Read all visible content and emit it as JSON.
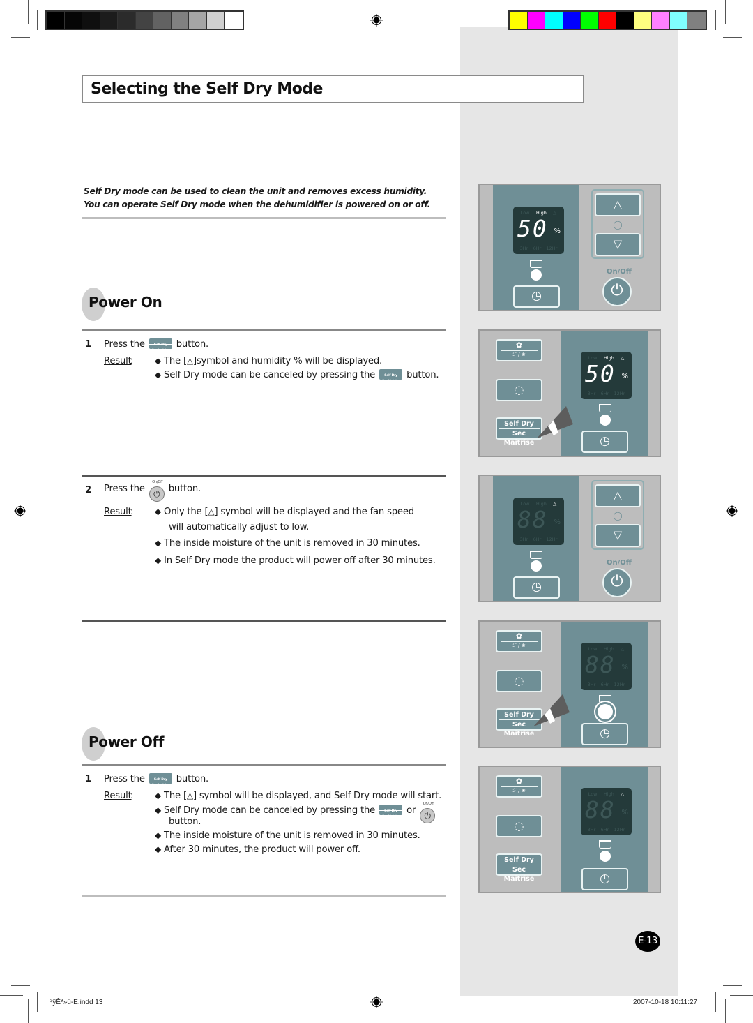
{
  "print_marks": {
    "gray_bar": [
      "#000000",
      "#060606",
      "#0f0f0f",
      "#1c1c1c",
      "#2b2b2b",
      "#434343",
      "#626262",
      "#808080",
      "#a5a5a5",
      "#d0d0d0",
      "#ffffff"
    ],
    "color_bar": [
      "#ffff00",
      "#ff00ff",
      "#00ffff",
      "#0000ff",
      "#00ff00",
      "#ff0000",
      "#000000",
      "#ffff80",
      "#ff80ff",
      "#80ffff",
      "#808080"
    ]
  },
  "page": {
    "title": "Selecting the Self Dry Mode",
    "intro_line1": "Self Dry mode can be used to clean the unit and removes excess humidity.",
    "intro_line2": "You can operate Self Dry mode when the dehumidifier is powered on or off.",
    "page_number": "E-13"
  },
  "power_on": {
    "heading": "Power On",
    "step1": {
      "num": "1",
      "press_prefix": "Press the",
      "press_suffix": "button.",
      "result_label": "Result",
      "bullets": [
        {
          "pre": "The [",
          "post": "]symbol and humidity % will be displayed."
        },
        {
          "pre": "Self Dry mode can be canceled by pressing the",
          "post": "button."
        }
      ]
    },
    "step2": {
      "num": "2",
      "press_prefix": "Press the",
      "press_suffix": "button.",
      "result_label": "Result",
      "bullets": [
        {
          "pre": "Only the [",
          "post": "] symbol will be displayed and the fan speed",
          "cont": "will automatically adjust to low."
        },
        {
          "text": "The inside moisture of the unit is removed in 30 minutes."
        },
        {
          "text": "In Self Dry mode the product will power off after 30 minutes."
        }
      ]
    }
  },
  "power_off": {
    "heading": "Power Off",
    "step1": {
      "num": "1",
      "press_prefix": "Press the",
      "press_suffix": "button.",
      "result_label": "Result",
      "bullets": [
        {
          "pre": "The [",
          "post": "] symbol will be displayed, and Self Dry mode will start."
        },
        {
          "pre": "Self Dry mode can be canceled by pressing the",
          "mid": "or",
          "cont": "button."
        },
        {
          "text": "The inside moisture of the unit is removed in 30 minutes."
        },
        {
          "text": "After 30 minutes, the product will power off."
        }
      ]
    }
  },
  "inline_icons": {
    "self_dry_top": "Self Dry",
    "self_dry_bottom": "Sec Maitrise",
    "onoff_label": "On/Off",
    "bullet_glyph": "◆",
    "drop_glyph": "💧"
  },
  "panels": {
    "display_labels": {
      "low": "Low",
      "high": "High",
      "hr3": "3Hr",
      "hr6": "6Hr",
      "hr12": "12Hr",
      "pct": "%"
    },
    "onoff_label": "On/Off",
    "self_dry_top": "Self Dry",
    "self_dry_bottom": "Sec Maitrise",
    "up_glyph": "△",
    "down_glyph": "▽",
    "power_glyph": "⏻",
    "timer_glyph": "◷",
    "cycle_glyph": "◌",
    "fan_glyph": "✿",
    "fan_sub": "ℱ / ❀",
    "hum_glyph": "💧",
    "list": [
      {
        "digits": "50",
        "active": true
      },
      {
        "digits": "50",
        "active": true
      },
      {
        "digits": "88",
        "active": false
      },
      {
        "digits": "88",
        "active": false
      },
      {
        "digits": "88",
        "active": false
      }
    ]
  },
  "slug": {
    "file": "³ÿÊª»ú-E.indd   13",
    "timestamp": "2007-10-18   10:11:27"
  }
}
